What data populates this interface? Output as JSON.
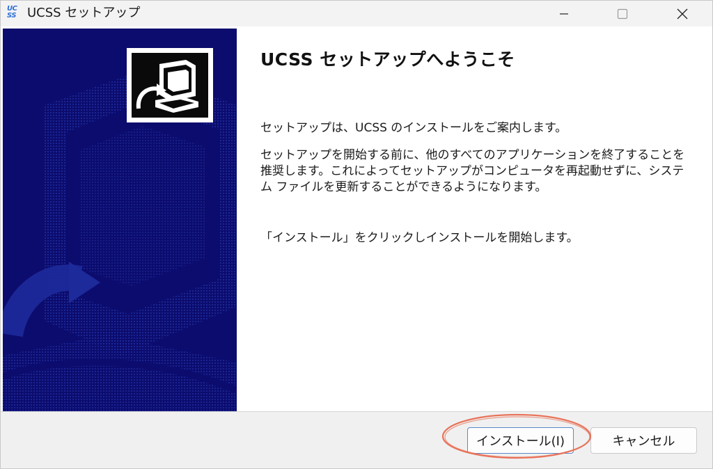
{
  "window": {
    "title": "UCSS セットアップ",
    "app_icon_lines": [
      "UC",
      "SS"
    ]
  },
  "content": {
    "heading": "UCSS セットアップへようこそ",
    "paragraph_1": "セットアップは、UCSS のインストールをご案内します。",
    "paragraph_2": "セットアップを開始する前に、他のすべてのアプリケーションを終了することを推奨します。これによってセットアップがコンピュータを再起動せずに、システム ファイルを更新することができるようになります。",
    "paragraph_3": "「インストール」をクリックしインストールを開始します。"
  },
  "buttons": {
    "install": "インストール(I)",
    "cancel": "キャンセル"
  },
  "icons": {
    "app": "ucss-app-icon",
    "minimize": "minimize-icon",
    "maximize": "maximize-icon",
    "close": "close-icon",
    "banner_logo": "installer-computer-icon"
  },
  "colors": {
    "banner_bg": "#0c0c6e",
    "highlight": "#e8735a",
    "accent_border": "#5a88c9"
  }
}
